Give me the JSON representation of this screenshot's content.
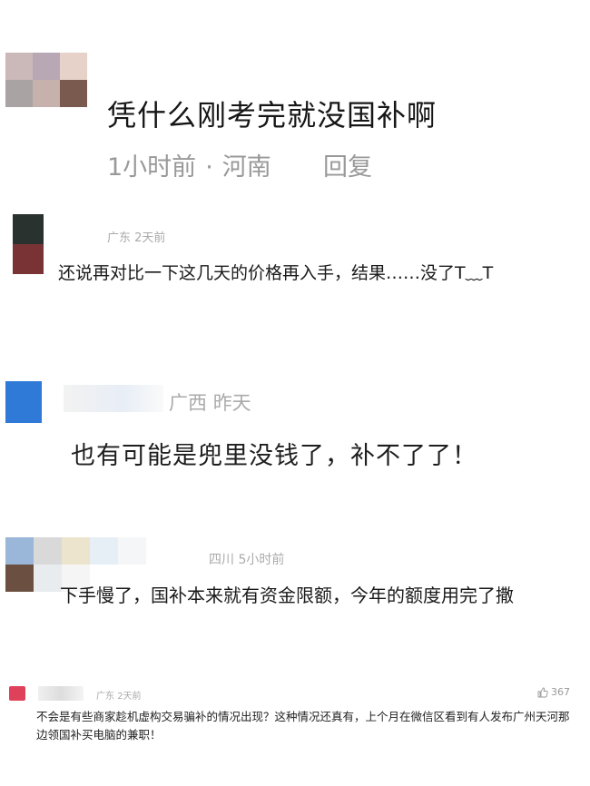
{
  "comments": [
    {
      "text": "凭什么刚考完就没国补啊",
      "time": "1小时前",
      "location": "河南",
      "separator": "·",
      "reply_label": "回复",
      "avatar_colors": [
        "#cbb8b8",
        "#b8a8b6",
        "#e6d2c8",
        "#a9a4a3",
        "#c7b1ac",
        "#7a5a4e"
      ]
    },
    {
      "location": "广东",
      "time": "2天前",
      "text": "还说再对比一下这几天的价格再入手，结果……没了T﹏T",
      "avatar_colors": [
        "#2a3230",
        "#7a3335"
      ]
    },
    {
      "location": "广西",
      "time": "昨天",
      "text": "也有可能是兜里没钱了，补不了了！",
      "avatar_colors": [
        "#2e7ad6"
      ]
    },
    {
      "location": "四川",
      "time": "5小时前",
      "text": "下手慢了，国补本来就有资金限额，今年的额度用完了撒",
      "avatar_colors": [
        "#9ab6d8",
        "#d9d9d9",
        "#ece4cc",
        "#e6eef6",
        "#f4f6f8",
        "#6b5041",
        "#e8ecef",
        "#f5f5f5",
        "#ffffff",
        "#ffffff"
      ]
    },
    {
      "location": "广东",
      "time": "2天前",
      "text": "不会是有些商家趁机虚构交易骗补的情况出现？这种情况还真有，上个月在微信区看到有人发布广州天河那边领国补买电脑的兼职！",
      "like_count": "367",
      "avatar_colors": [
        "#e0415a"
      ]
    }
  ]
}
